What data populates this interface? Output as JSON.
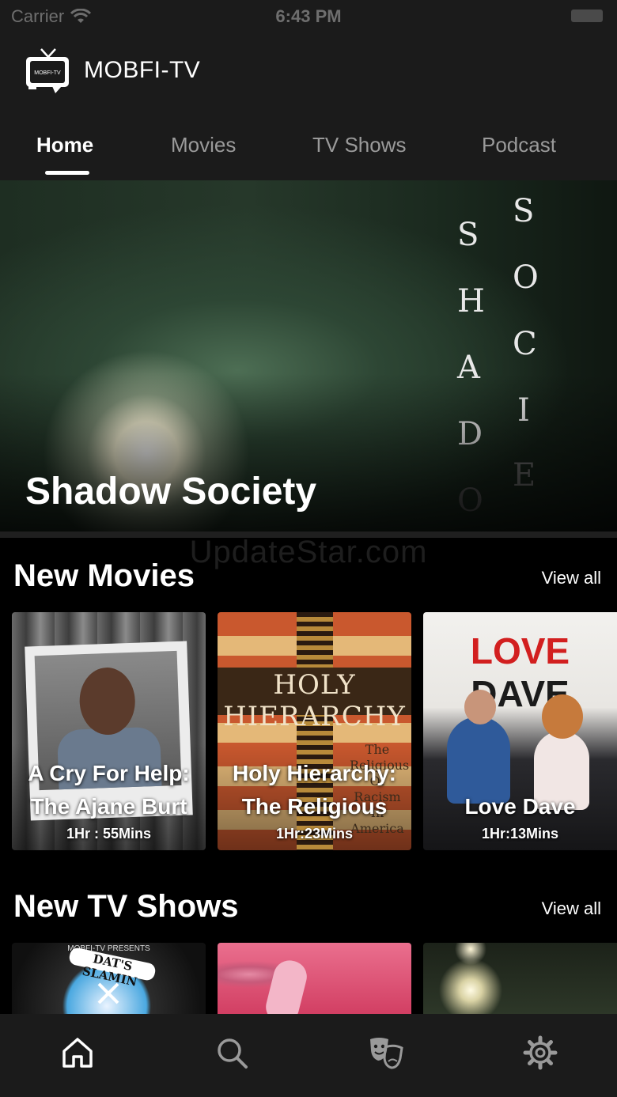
{
  "status_bar": {
    "carrier": "Carrier",
    "time": "6:43 PM"
  },
  "header": {
    "logo_text": "MOBFI-TV",
    "app_name": "MOBFI-TV"
  },
  "tabs": [
    {
      "label": "Home",
      "active": true
    },
    {
      "label": "Movies",
      "active": false
    },
    {
      "label": "TV Shows",
      "active": false
    },
    {
      "label": "Podcast",
      "active": false
    }
  ],
  "hero": {
    "title": "Shadow Society",
    "poster_letters_left": "SHADO",
    "poster_letters_right": "SOCIE"
  },
  "watermark": "UpdateStar.com",
  "new_movies": {
    "title": "New Movies",
    "view_all": "View all",
    "items": [
      {
        "title_line1": "A Cry For Help:",
        "title_line2": "The Ajane Burt",
        "duration": "1Hr : 55Mins"
      },
      {
        "title_line1": "Holy Hierarchy:",
        "title_line2": "The Religious",
        "duration": "1Hr:23Mins",
        "poster_heading": "HOLY HIERARCHY",
        "poster_subtext": "The Religious Of Racism In America"
      },
      {
        "title_line1": "Love Dave",
        "duration": "1Hr:13Mins",
        "poster_word1": "LOVE",
        "poster_word2": "DAVE"
      }
    ]
  },
  "new_tv_shows": {
    "title": "New TV Shows",
    "view_all": "View all",
    "items": [
      {
        "poster_top": "MOBFI-TV PRESENTS",
        "poster_banner": "DAT'S SLAMIN"
      },
      {},
      {}
    ]
  },
  "bottom_nav": {
    "items": [
      "home-icon",
      "search-icon",
      "theater-masks-icon",
      "gear-icon"
    ]
  },
  "colors": {
    "background": "#000000",
    "bar": "#1b1b1b",
    "tab_inactive": "#9a9a9a",
    "text": "#ffffff"
  }
}
